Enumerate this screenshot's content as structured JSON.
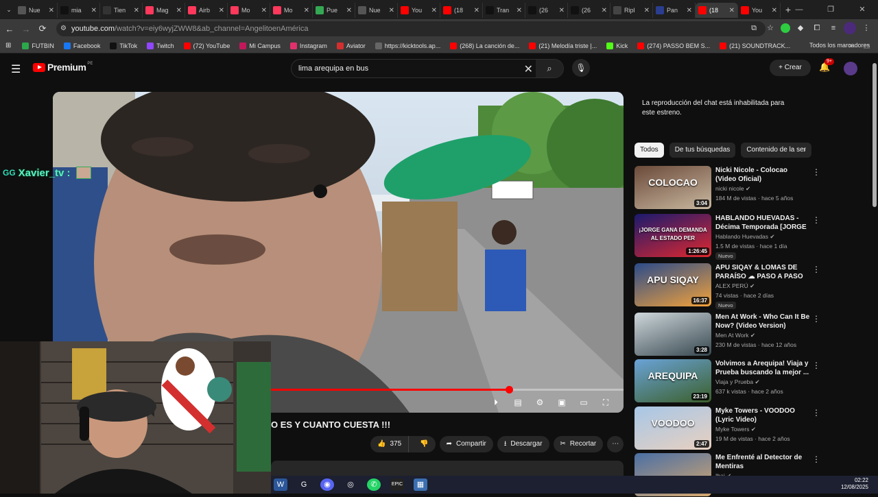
{
  "tabs": [
    {
      "label": "Nue",
      "fav": "chrome-icon",
      "color": "#555"
    },
    {
      "label": "mia",
      "fav": "tiktok-icon",
      "color": "#111"
    },
    {
      "label": "Tien",
      "fav": "epic-icon",
      "color": "#333"
    },
    {
      "label": "Mag",
      "fav": "airbnb-icon",
      "color": "#ff385c"
    },
    {
      "label": "Airb",
      "fav": "airbnb-icon",
      "color": "#ff385c"
    },
    {
      "label": "Mo",
      "fav": "airbnb-icon",
      "color": "#ff385c"
    },
    {
      "label": "Mo",
      "fav": "airbnb-icon",
      "color": "#ff385c"
    },
    {
      "label": "Pue",
      "fav": "maps-icon",
      "color": "#34a853"
    },
    {
      "label": "Nue",
      "fav": "chrome-icon",
      "color": "#555"
    },
    {
      "label": "You",
      "fav": "youtube-icon",
      "color": "#ff0000"
    },
    {
      "label": "(18",
      "fav": "youtube-icon",
      "color": "#ff0000"
    },
    {
      "label": "Tran",
      "fav": "tiktok-icon",
      "color": "#111"
    },
    {
      "label": "(26",
      "fav": "tiktok-icon",
      "color": "#111"
    },
    {
      "label": "(26",
      "fav": "tiktok-icon",
      "color": "#111"
    },
    {
      "label": "Ripl",
      "fav": "ripio-icon",
      "color": "#444"
    },
    {
      "label": "Pan",
      "fav": "pan-icon",
      "color": "#2a3d8f"
    },
    {
      "label": "(18",
      "fav": "youtube-icon",
      "color": "#ff0000",
      "active": true
    },
    {
      "label": "You",
      "fav": "youtube-icon",
      "color": "#ff0000"
    }
  ],
  "address": {
    "host": "youtube.com",
    "path": "/watch?v=eiy6wyjZWW8&ab_channel=AngelitoenAmérica"
  },
  "bookmarks": [
    {
      "label": "FUTBIN",
      "color": "#2ba84a"
    },
    {
      "label": "Facebook",
      "color": "#1877f2"
    },
    {
      "label": "TikTok",
      "color": "#111"
    },
    {
      "label": "Twitch",
      "color": "#9146ff"
    },
    {
      "label": "(72) YouTube",
      "color": "#ff0000"
    },
    {
      "label": "Mi Campus",
      "color": "#c2185b"
    },
    {
      "label": "Instagram",
      "color": "#e1306c"
    },
    {
      "label": "Aviator",
      "color": "#d32f2f"
    },
    {
      "label": "https://kicktools.ap...",
      "color": "#666"
    },
    {
      "label": "(268) La canción de...",
      "color": "#ff0000"
    },
    {
      "label": "(21) Melodía triste |...",
      "color": "#ff0000"
    },
    {
      "label": "Kick",
      "color": "#53fc18"
    },
    {
      "label": "(274) PASSO BEM S...",
      "color": "#ff0000"
    },
    {
      "label": "(21) SOUNDTRACK...",
      "color": "#ff0000"
    }
  ],
  "bookmarks_overflow": "»",
  "bookmarks_folder": "Todos los marcadores",
  "yt": {
    "logo": "Premium",
    "country": "PE",
    "search_value": "lima arequipa en  bus",
    "create": "Crear",
    "notif_count": "9+"
  },
  "overlay": {
    "gg": "GG",
    "name": "Xavier_tv :"
  },
  "video": {
    "title_visible": "O ES Y CUANTO CUESTA !!!",
    "progress": 0.675,
    "likes": "375",
    "share": "Compartir",
    "download": "Descargar",
    "clip": "Recortar"
  },
  "chat_disabled": "La reproducción del chat está inhabilitada para este estreno.",
  "chips": [
    "Todos",
    "De tus búsquedas",
    "Contenido de la ser"
  ],
  "recommendations": [
    {
      "title": "Nicki Nicole - Colocao (Video Oficial)",
      "channel": "nicki nicole",
      "meta": "184 M de vistas · hace 5 años",
      "duration": "3:04",
      "thumb_text": "COLOCAO",
      "thumb_colors": [
        "#6b4a3a",
        "#c9b8a0"
      ],
      "nuevo": ""
    },
    {
      "title": "HABLANDO HUEVADAS - Décima Temporada [JORGE ...",
      "channel": "Hablando Huevadas",
      "meta": "1.5 M de vistas · hace 1 día",
      "duration": "1:26:45",
      "thumb_text": "¡JORGE GANA DEMANDA AL ESTADO PER",
      "thumb_colors": [
        "#1a1a6e",
        "#e0282e"
      ],
      "nuevo": "Nuevo"
    },
    {
      "title": "APU SIQAY & LOMAS DE PARAÍSO ☁ PASO A PASO PE ...",
      "channel": "ALEX PERÚ",
      "meta": "74 vistas · hace 2 días",
      "duration": "16:37",
      "thumb_text": "APU SIQAY",
      "thumb_colors": [
        "#2b4b8a",
        "#f3a23a"
      ],
      "nuevo": "Nuevo"
    },
    {
      "title": "Men At Work - Who Can It Be Now? (Video Version)",
      "channel": "Men At Work",
      "meta": "230 M de vistas · hace 12 años",
      "duration": "3:28",
      "thumb_text": "",
      "thumb_colors": [
        "#cfd8dc",
        "#37474f"
      ],
      "nuevo": ""
    },
    {
      "title": "Volvimos a Arequipa! Viaja y Prueba buscando la mejor ...",
      "channel": "Viaja y Prueba",
      "meta": "637 k vistas · hace 2 años",
      "duration": "23:19",
      "thumb_text": "AREQUIPA",
      "thumb_colors": [
        "#6aa3d8",
        "#3b5f2a"
      ],
      "nuevo": ""
    },
    {
      "title": "Myke Towers - VOODOO (Lyric Video)",
      "channel": "Myke Towers",
      "meta": "19 M de vistas · hace 2 años",
      "duration": "2:47",
      "thumb_text": "VOODOO",
      "thumb_colors": [
        "#a7c7e7",
        "#e8d0c0"
      ],
      "nuevo": ""
    },
    {
      "title": "Me Enfrenté al Detector de Mentiras",
      "channel": "Ibai",
      "meta": "",
      "duration": "",
      "thumb_text": "",
      "thumb_colors": [
        "#4a6fa5",
        "#d7a86e"
      ],
      "nuevo": ""
    }
  ],
  "clock": {
    "time": "02:22",
    "date": "12/08/2025"
  }
}
